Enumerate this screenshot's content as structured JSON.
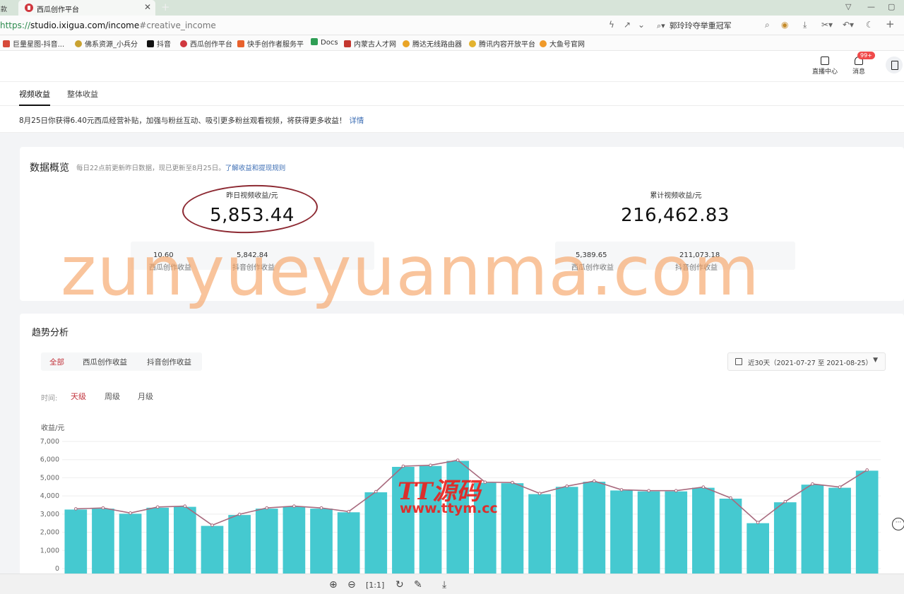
{
  "browser": {
    "prev_tab_stub": "款",
    "active_tab_title": "西瓜创作平台",
    "url_scheme": "https://",
    "url_host_path": "studio.ixigua.com/income",
    "url_hash": "#creative_income",
    "search_text": "郭玲玲夺举重冠军"
  },
  "bookmarks": [
    {
      "label": "巨量星图-抖音...",
      "color": "#d64a3a"
    },
    {
      "label": "佛系资源_小兵分",
      "color": "#c9a231"
    },
    {
      "label": "抖音",
      "color": "#111111"
    },
    {
      "label": "西瓜创作平台",
      "color": "#d0383f"
    },
    {
      "label": "快手创作者服务平",
      "color": "#e8612c"
    },
    {
      "label": "Docs",
      "color": "#2f9e55"
    },
    {
      "label": "内蒙古人才网",
      "color": "#c4372f"
    },
    {
      "label": "腾达无线路由器",
      "color": "#e9a425"
    },
    {
      "label": "腾讯内容开放平台",
      "color": "#e3b22e"
    },
    {
      "label": "大鱼号官网",
      "color": "#f09a2a"
    }
  ],
  "header": {
    "live_center": "直播中心",
    "messages": "消息",
    "message_badge": "99+"
  },
  "tabs": [
    "视频收益",
    "整体收益"
  ],
  "notice": {
    "text": "8月25日你获得6.40元西瓜经营补贴，加强与粉丝互动、吸引更多粉丝观看视频，将获得更多收益！",
    "link": "详情"
  },
  "overview": {
    "title": "数据概览",
    "desc": "每日22点前更新昨日数据，现已更新至8月25日。",
    "desc_link": "了解收益和提现规则",
    "yesterday_label": "昨日视频收益/元",
    "yesterday_value": "5,853.44",
    "yesterday_xigua_label": "西瓜创作收益",
    "yesterday_xigua_value": "10.60",
    "yesterday_douyin_label": "抖音创作收益",
    "yesterday_douyin_value": "5,842.84",
    "total_label": "累计视频收益/元",
    "total_value": "216,462.83",
    "total_xigua_label": "西瓜创作收益",
    "total_xigua_value": "5,389.65",
    "total_douyin_label": "抖音创作收益",
    "total_douyin_value": "211,073.18"
  },
  "trend": {
    "title": "趋势分析",
    "segments": [
      "全部",
      "西瓜创作收益",
      "抖音创作收益"
    ],
    "date_range": "近30天（2021-07-27 至 2021-08-25）",
    "granularity_label": "时间:",
    "granularity": [
      "天级",
      "周级",
      "月级"
    ]
  },
  "chart_data": {
    "type": "bar",
    "ylabel": "收益/元",
    "ylim": [
      0,
      7000
    ],
    "y_ticks": [
      "0",
      "1,000",
      "2,000",
      "3,000",
      "4,000",
      "5,000",
      "6,000",
      "7,000"
    ],
    "bar_color": "#45c9d0",
    "line_color": "#a86a7e",
    "series": [
      {
        "values": [
          3250,
          3300,
          3020,
          3350,
          3400,
          2350,
          2950,
          3300,
          3400,
          3300,
          3100,
          4200,
          5600,
          5650,
          5930,
          4720,
          4700,
          4100,
          4500,
          4780,
          4300,
          4250,
          4250,
          4450,
          3850,
          2500,
          3650,
          4620,
          4450,
          5390
        ]
      }
    ]
  },
  "watermarks": {
    "main": "zunyueyuanma.com",
    "logo": "TT源码",
    "logo_url": "www.ttym.cc"
  }
}
